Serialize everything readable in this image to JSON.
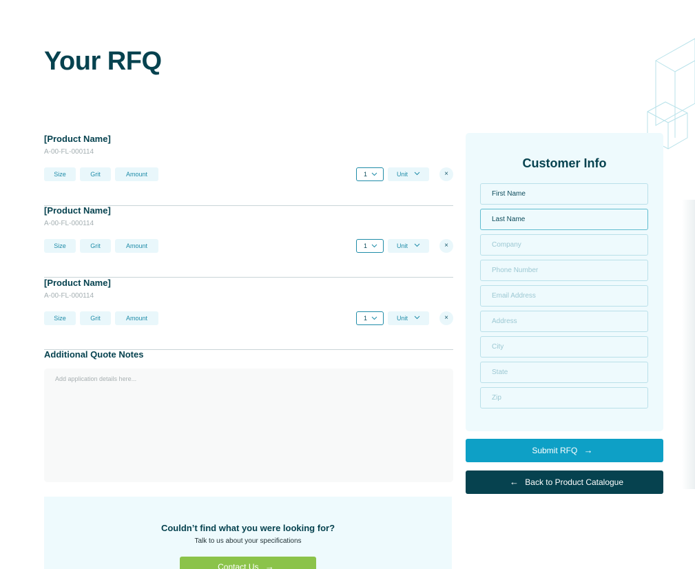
{
  "page": {
    "title": "Your RFQ"
  },
  "products": [
    {
      "name": "[Product Name]",
      "sku": "A-00-FL-000114",
      "size_label": "Size",
      "grit_label": "Grit",
      "amount_label": "Amount",
      "qty": "1",
      "unit_label": "Unit",
      "remove_icon": "×"
    },
    {
      "name": "[Product Name]",
      "sku": "A-00-FL-000114",
      "size_label": "Size",
      "grit_label": "Grit",
      "amount_label": "Amount",
      "qty": "1",
      "unit_label": "Unit",
      "remove_icon": "×"
    },
    {
      "name": "[Product Name]",
      "sku": "A-00-FL-000114",
      "size_label": "Size",
      "grit_label": "Grit",
      "amount_label": "Amount",
      "qty": "1",
      "unit_label": "Unit",
      "remove_icon": "×"
    }
  ],
  "notes": {
    "title": "Additional Quote Notes",
    "placeholder": "Add application details here..."
  },
  "help": {
    "title": "Couldn’t find what you were looking for?",
    "subtitle": "Talk to us about your specifications",
    "button": "Contact Us",
    "button_icon": "→"
  },
  "customer_info": {
    "title": "Customer Info",
    "fields": [
      {
        "placeholder": "First Name"
      },
      {
        "placeholder": "Last Name"
      },
      {
        "placeholder": "Company"
      },
      {
        "placeholder": "Phone Number"
      },
      {
        "placeholder": "Email Address"
      },
      {
        "placeholder": "Address"
      },
      {
        "placeholder": "City"
      },
      {
        "placeholder": "State"
      },
      {
        "placeholder": "Zip"
      }
    ]
  },
  "actions": {
    "submit_label": "Submit RFQ",
    "submit_icon": "→",
    "back_label": "Back to Product Catalogue",
    "back_icon": "←"
  },
  "colors": {
    "primary": "#06424f",
    "accent": "#0ea0c6",
    "success": "#8bc34a",
    "panel": "#eefafd"
  }
}
